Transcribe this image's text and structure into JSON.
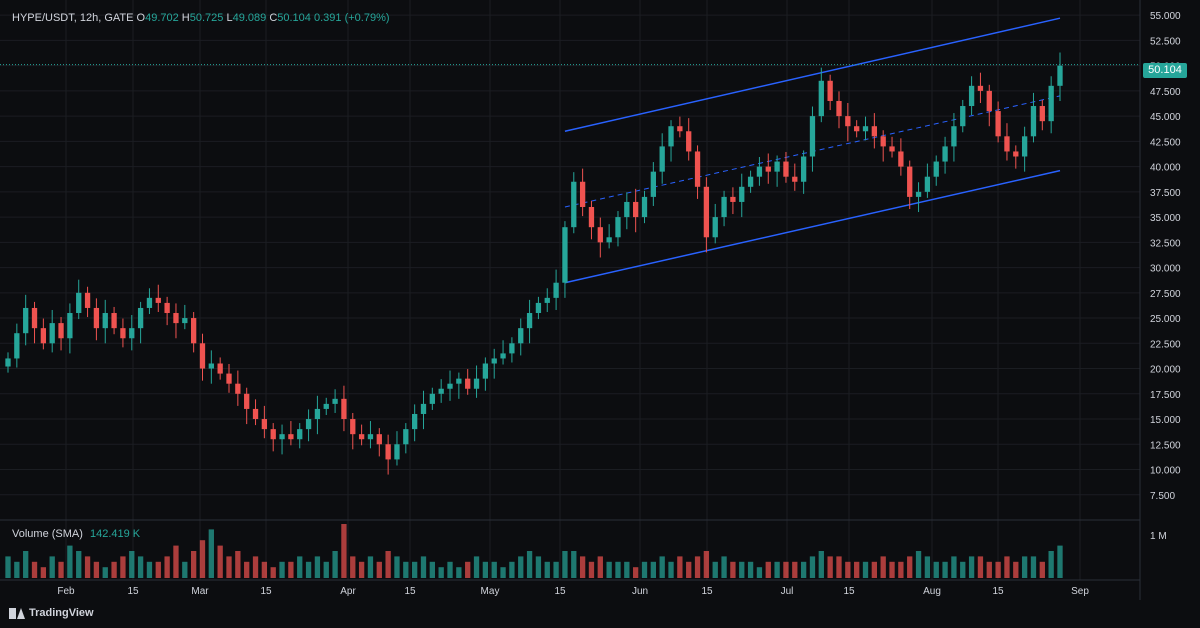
{
  "header": {
    "symbol": "HYPE/USDT, 12h, GATE",
    "ohlc": [
      {
        "label": "O",
        "value": "49.702"
      },
      {
        "label": "H",
        "value": "50.725"
      },
      {
        "label": "L",
        "value": "49.089"
      },
      {
        "label": "C",
        "value": "50.104"
      },
      {
        "label": "",
        "value": "0.391 (+0.79%)"
      }
    ]
  },
  "last_price": "50.104",
  "volume": {
    "label": "Volume (SMA)",
    "value": "142.419 K",
    "axis_label": "1 M"
  },
  "branding": {
    "name": "TradingView",
    "icon": "tradingview-logo-icon"
  },
  "colors": {
    "up": "#26a69a",
    "down": "#ef5350",
    "channel": "#2962ff",
    "background": "#0c0d10",
    "grid": "#1b1d22"
  },
  "chart_data": {
    "type": "line",
    "subtype": "candlestick",
    "ylim": [
      5,
      56.5
    ],
    "y_ticks": [
      "55.000",
      "52.500",
      "50.000",
      "47.500",
      "45.000",
      "42.500",
      "40.000",
      "37.500",
      "35.000",
      "32.500",
      "30.000",
      "27.500",
      "25.000",
      "22.500",
      "20.000",
      "17.500",
      "15.000",
      "12.500",
      "10.000",
      "7.500"
    ],
    "x_ticks": [
      "Feb",
      "15",
      "Mar",
      "15",
      "Apr",
      "15",
      "May",
      "15",
      "Jun",
      "15",
      "Jul",
      "15",
      "Aug",
      "15",
      "Sep"
    ],
    "series": [
      {
        "values": [
          [
            1,
            21
          ],
          [
            2,
            23.5
          ],
          [
            3,
            26
          ],
          [
            4,
            24
          ],
          [
            5,
            22.5
          ],
          [
            6,
            24.5
          ],
          [
            7,
            23
          ],
          [
            8,
            25.5
          ],
          [
            9,
            27.5
          ],
          [
            10,
            26
          ],
          [
            11,
            24
          ],
          [
            12,
            25.5
          ],
          [
            13,
            24
          ],
          [
            14,
            23
          ],
          [
            15,
            24
          ],
          [
            16,
            26
          ],
          [
            17,
            27
          ],
          [
            18,
            26.5
          ],
          [
            19,
            25.5
          ],
          [
            20,
            24.5
          ],
          [
            21,
            25
          ],
          [
            22,
            22.5
          ],
          [
            23,
            20
          ],
          [
            24,
            20.5
          ],
          [
            25,
            19.5
          ],
          [
            26,
            18.5
          ],
          [
            27,
            17.5
          ],
          [
            28,
            16
          ],
          [
            29,
            15
          ],
          [
            30,
            14
          ],
          [
            31,
            13
          ],
          [
            32,
            13.5
          ],
          [
            33,
            13
          ],
          [
            34,
            14
          ],
          [
            35,
            15
          ],
          [
            36,
            16
          ],
          [
            37,
            16.5
          ],
          [
            38,
            17
          ],
          [
            39,
            15
          ],
          [
            40,
            13.5
          ],
          [
            41,
            13
          ],
          [
            42,
            13.5
          ],
          [
            43,
            12.5
          ],
          [
            44,
            11
          ],
          [
            45,
            12.5
          ],
          [
            46,
            14
          ],
          [
            47,
            15.5
          ],
          [
            48,
            16.5
          ],
          [
            49,
            17.5
          ],
          [
            50,
            18
          ],
          [
            51,
            18.5
          ],
          [
            52,
            19
          ],
          [
            53,
            18
          ],
          [
            54,
            19
          ],
          [
            55,
            20.5
          ],
          [
            56,
            21
          ],
          [
            57,
            21.5
          ],
          [
            58,
            22.5
          ],
          [
            59,
            24
          ],
          [
            60,
            25.5
          ],
          [
            61,
            26.5
          ],
          [
            62,
            27
          ],
          [
            63,
            28.5
          ],
          [
            64,
            34
          ],
          [
            65,
            38.5
          ],
          [
            66,
            36
          ],
          [
            67,
            34
          ],
          [
            68,
            32.5
          ],
          [
            69,
            33
          ],
          [
            70,
            35
          ],
          [
            71,
            36.5
          ],
          [
            72,
            35
          ],
          [
            73,
            37
          ],
          [
            74,
            39.5
          ],
          [
            75,
            42
          ],
          [
            76,
            44
          ],
          [
            77,
            43.5
          ],
          [
            78,
            41.5
          ],
          [
            79,
            38
          ],
          [
            80,
            33
          ],
          [
            81,
            35
          ],
          [
            82,
            37
          ],
          [
            83,
            36.5
          ],
          [
            84,
            38
          ],
          [
            85,
            39
          ],
          [
            86,
            40
          ],
          [
            87,
            39.5
          ],
          [
            88,
            40.5
          ],
          [
            89,
            39
          ],
          [
            90,
            38.5
          ],
          [
            91,
            41
          ],
          [
            92,
            45
          ],
          [
            93,
            48.5
          ],
          [
            94,
            46.5
          ],
          [
            95,
            45
          ],
          [
            96,
            44
          ],
          [
            97,
            43.5
          ],
          [
            98,
            44
          ],
          [
            99,
            43
          ],
          [
            100,
            42
          ],
          [
            101,
            41.5
          ],
          [
            102,
            40
          ],
          [
            103,
            37
          ],
          [
            104,
            37.5
          ],
          [
            105,
            39
          ],
          [
            106,
            40.5
          ],
          [
            107,
            42
          ],
          [
            108,
            44
          ],
          [
            109,
            46
          ],
          [
            110,
            48
          ],
          [
            111,
            47.5
          ],
          [
            112,
            45.5
          ],
          [
            113,
            43
          ],
          [
            114,
            41.5
          ],
          [
            115,
            41
          ],
          [
            116,
            43
          ],
          [
            117,
            46
          ],
          [
            118,
            44.5
          ],
          [
            119,
            48
          ],
          [
            120,
            50
          ]
        ]
      }
    ],
    "volume_values": [
      0.4,
      0.3,
      0.5,
      0.3,
      0.2,
      0.4,
      0.3,
      0.6,
      0.5,
      0.4,
      0.3,
      0.2,
      0.3,
      0.4,
      0.5,
      0.4,
      0.3,
      0.3,
      0.4,
      0.6,
      0.3,
      0.5,
      0.7,
      0.9,
      0.6,
      0.4,
      0.5,
      0.3,
      0.4,
      0.3,
      0.2,
      0.3,
      0.3,
      0.4,
      0.3,
      0.4,
      0.3,
      0.5,
      1.0,
      0.4,
      0.3,
      0.4,
      0.3,
      0.5,
      0.4,
      0.3,
      0.3,
      0.4,
      0.3,
      0.2,
      0.3,
      0.2,
      0.3,
      0.4,
      0.3,
      0.3,
      0.2,
      0.3,
      0.4,
      0.5,
      0.4,
      0.3,
      0.3,
      0.5,
      0.5,
      0.4,
      0.3,
      0.4,
      0.3,
      0.3,
      0.3,
      0.2,
      0.3,
      0.3,
      0.4,
      0.3,
      0.4,
      0.3,
      0.4,
      0.5,
      0.3,
      0.4,
      0.3,
      0.3,
      0.3,
      0.2,
      0.3,
      0.3,
      0.3,
      0.3,
      0.3,
      0.4,
      0.5,
      0.4,
      0.4,
      0.3,
      0.3,
      0.3,
      0.3,
      0.4,
      0.3,
      0.3,
      0.4,
      0.5,
      0.4,
      0.3,
      0.3,
      0.4,
      0.3,
      0.4,
      0.4,
      0.3,
      0.3,
      0.4,
      0.3,
      0.4,
      0.4,
      0.3,
      0.5,
      0.6
    ],
    "channel": {
      "upper": [
        [
          64,
          43.5
        ],
        [
          120,
          54.7
        ]
      ],
      "middle": [
        [
          64,
          36
        ],
        [
          120,
          47
        ]
      ],
      "lower": [
        [
          64,
          28.5
        ],
        [
          120,
          39.6
        ]
      ]
    },
    "last_price_value": 50.104,
    "grid": true,
    "legend": "top-left"
  }
}
